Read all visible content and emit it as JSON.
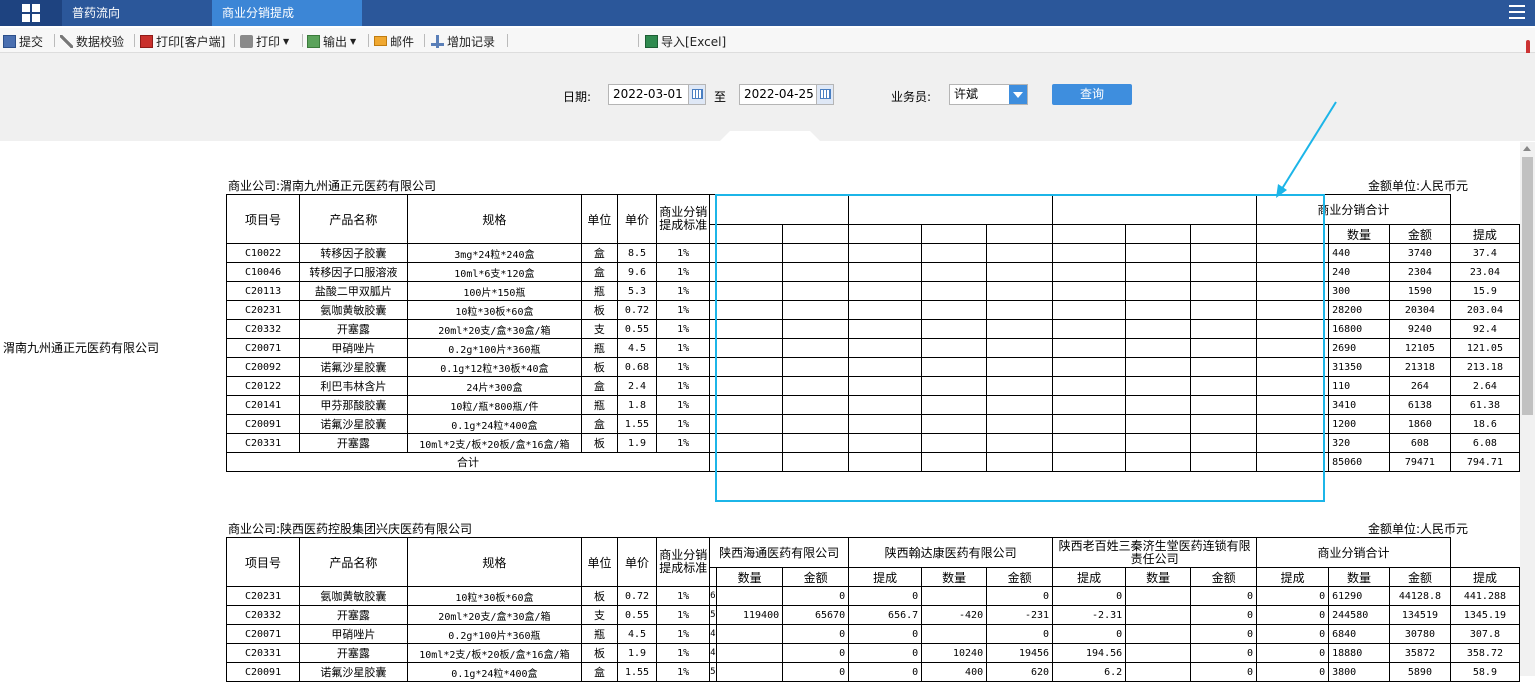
{
  "header": {
    "tabs": [
      {
        "label": "普药流向"
      },
      {
        "label": "商业分销提成"
      }
    ]
  },
  "toolbar": {
    "submit": "提交",
    "validate": "数据校验",
    "print_client": "打印[客户端]",
    "print": "打印",
    "export": "输出",
    "mail": "邮件",
    "add_record": "增加记录",
    "import_excel": "导入[Excel]"
  },
  "filter": {
    "date_label": "日期:",
    "date_from": "2022-03-01",
    "to_label": "至",
    "date_to": "2022-04-25",
    "salesman_label": "业务员:",
    "salesman": "许斌",
    "query_button": "查询"
  },
  "left_company": "渭南九州通正元医药有限公司",
  "columns": {
    "item_no": "项目号",
    "product_name": "产品名称",
    "spec": "规格",
    "unit": "单位",
    "price": "单价",
    "commission_std": "商业分销提成标准",
    "qty": "数量",
    "amount": "金额",
    "commission": "提成",
    "total_group": "商业分销合计",
    "total_row": "合计"
  },
  "report1": {
    "company_label": "商业公司:渭南九州通正元医药有限公司",
    "currency_label": "金额单位:人民币元",
    "rows": [
      {
        "id": "C10022",
        "name": "转移因子胶囊",
        "spec": "3mg*24粒*240盒",
        "unit": "盒",
        "price": "8.5",
        "rate": "1%",
        "q": "440",
        "a": "3740",
        "c": "37.4"
      },
      {
        "id": "C10046",
        "name": "转移因子口服溶液",
        "spec": "10ml*6支*120盒",
        "unit": "盒",
        "price": "9.6",
        "rate": "1%",
        "q": "240",
        "a": "2304",
        "c": "23.04"
      },
      {
        "id": "C20113",
        "name": "盐酸二甲双胍片",
        "spec": "100片*150瓶",
        "unit": "瓶",
        "price": "5.3",
        "rate": "1%",
        "q": "300",
        "a": "1590",
        "c": "15.9"
      },
      {
        "id": "C20231",
        "name": "氨咖黄敏胶囊",
        "spec": "10粒*30板*60盒",
        "unit": "板",
        "price": "0.72",
        "rate": "1%",
        "q": "28200",
        "a": "20304",
        "c": "203.04"
      },
      {
        "id": "C20332",
        "name": "开塞露",
        "spec": "20ml*20支/盒*30盒/箱",
        "unit": "支",
        "price": "0.55",
        "rate": "1%",
        "q": "16800",
        "a": "9240",
        "c": "92.4"
      },
      {
        "id": "C20071",
        "name": "甲硝唑片",
        "spec": "0.2g*100片*360瓶",
        "unit": "瓶",
        "price": "4.5",
        "rate": "1%",
        "q": "2690",
        "a": "12105",
        "c": "121.05"
      },
      {
        "id": "C20092",
        "name": "诺氟沙星胶囊",
        "spec": "0.1g*12粒*30板*40盒",
        "unit": "板",
        "price": "0.68",
        "rate": "1%",
        "q": "31350",
        "a": "21318",
        "c": "213.18"
      },
      {
        "id": "C20122",
        "name": "利巴韦林含片",
        "spec": "24片*300盒",
        "unit": "盒",
        "price": "2.4",
        "rate": "1%",
        "q": "110",
        "a": "264",
        "c": "2.64"
      },
      {
        "id": "C20141",
        "name": "甲芬那酸胶囊",
        "spec": "10粒/瓶*800瓶/件",
        "unit": "瓶",
        "price": "1.8",
        "rate": "1%",
        "q": "3410",
        "a": "6138",
        "c": "61.38"
      },
      {
        "id": "C20091",
        "name": "诺氟沙星胶囊",
        "spec": "0.1g*24粒*400盒",
        "unit": "盒",
        "price": "1.55",
        "rate": "1%",
        "q": "1200",
        "a": "1860",
        "c": "18.6"
      },
      {
        "id": "C20331",
        "name": "开塞露",
        "spec": "10ml*2支/板*20板/盒*16盒/箱",
        "unit": "板",
        "price": "1.9",
        "rate": "1%",
        "q": "320",
        "a": "608",
        "c": "6.08"
      }
    ],
    "total": {
      "q": "85060",
      "a": "79471",
      "c": "794.71"
    }
  },
  "report2": {
    "company_label": "商业公司:陕西医药控股集团兴庆医药有限公司",
    "currency_label": "金额单位:人民币元",
    "groups": [
      "陕西海通医药有限公司",
      "陕西翰达康医药有限公司",
      "陕西老百姓三秦济生堂医药连锁有限责任公司"
    ],
    "rows": [
      {
        "id": "C20231",
        "name": "氨咖黄敏胶囊",
        "spec": "10粒*30板*60盒",
        "unit": "板",
        "price": "0.72",
        "rate": "1%",
        "m": "6",
        "v": [
          "",
          "0",
          "0",
          "",
          "0",
          "0",
          "",
          "0",
          "0"
        ],
        "q": "61290",
        "a": "44128.8",
        "c": "441.288"
      },
      {
        "id": "C20332",
        "name": "开塞露",
        "spec": "20ml*20支/盒*30盒/箱",
        "unit": "支",
        "price": "0.55",
        "rate": "1%",
        "m": "5",
        "v": [
          "119400",
          "65670",
          "656.7",
          "-420",
          "-231",
          "-2.31",
          "",
          "0",
          "0"
        ],
        "q": "244580",
        "a": "134519",
        "c": "1345.19"
      },
      {
        "id": "C20071",
        "name": "甲硝唑片",
        "spec": "0.2g*100片*360瓶",
        "unit": "瓶",
        "price": "4.5",
        "rate": "1%",
        "m": "4",
        "v": [
          "",
          "0",
          "0",
          "",
          "0",
          "0",
          "",
          "0",
          "0"
        ],
        "q": "6840",
        "a": "30780",
        "c": "307.8"
      },
      {
        "id": "C20331",
        "name": "开塞露",
        "spec": "10ml*2支/板*20板/盒*16盒/箱",
        "unit": "板",
        "price": "1.9",
        "rate": "1%",
        "m": "4",
        "v": [
          "",
          "0",
          "0",
          "10240",
          "19456",
          "194.56",
          "",
          "0",
          "0"
        ],
        "q": "18880",
        "a": "35872",
        "c": "358.72"
      },
      {
        "id": "C20091",
        "name": "诺氟沙星胶囊",
        "spec": "0.1g*24粒*400盒",
        "unit": "盒",
        "price": "1.55",
        "rate": "1%",
        "m": "5",
        "v": [
          "",
          "0",
          "0",
          "400",
          "620",
          "6.2",
          "",
          "0",
          "0"
        ],
        "q": "3800",
        "a": "5890",
        "c": "58.9"
      }
    ]
  },
  "annotation": {
    "color": "#1cb5e8"
  }
}
